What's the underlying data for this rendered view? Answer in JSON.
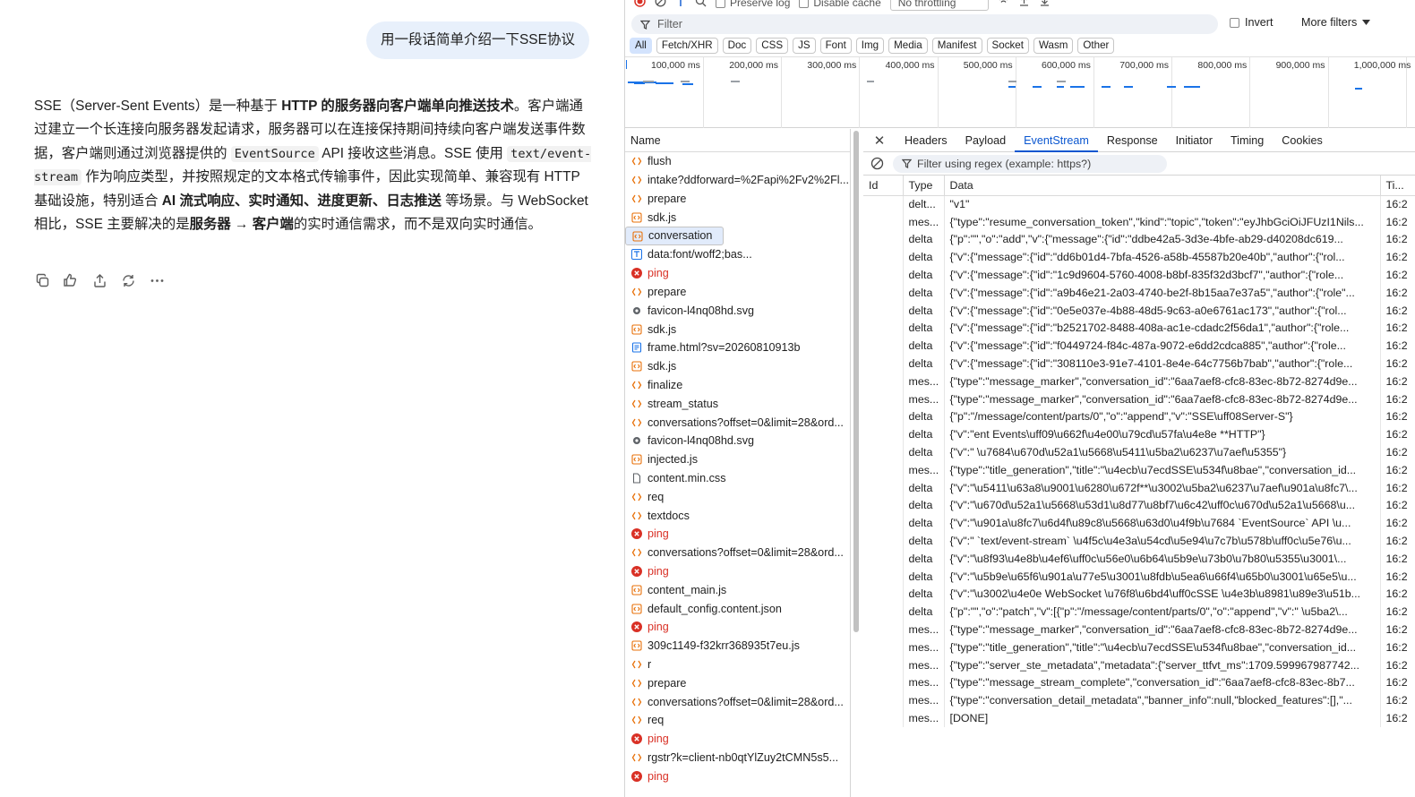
{
  "chat": {
    "user_message": "用一段话简单介绍一下SSE协议",
    "answer": {
      "p1": "SSE（Server-Sent Events）是一种基于 ",
      "b1": "HTTP 的服务器向客户端单向推送技术",
      "p2": "。客户端通过建立一个长连接向服务器发起请求，服务器可以在连接保持期间持续向客户端发送事件数据，客户端则通过浏览器提供的 ",
      "c1": "EventSource",
      "p3": " API 接收这些消息。SSE 使用 ",
      "c2": "text/event-stream",
      "p4": " 作为响应类型，并按照规定的文本格式传输事件，因此实现简单、兼容现有 HTTP 基础设施，特别适合 ",
      "b2": "AI 流式响应、实时通知、进度更新、日志推送",
      "p5": " 等场景。与 WebSocket 相比，SSE 主要解决的是",
      "b3": "服务器 → 客户端",
      "p6": "的实时通信需求，而不是双向实时通信。"
    },
    "actions": [
      "copy-icon",
      "thumbs-icon",
      "share-icon",
      "refresh-icon",
      "more-icon"
    ]
  },
  "devtools": {
    "toolbar": {
      "preserve_log": "Preserve log",
      "disable_cache": "Disable cache",
      "throttling": "No throttling"
    },
    "filter_placeholder": "Filter",
    "invert": "Invert",
    "more_filters": "More filters",
    "chips": [
      "All",
      "Fetch/XHR",
      "Doc",
      "CSS",
      "JS",
      "Font",
      "Img",
      "Media",
      "Manifest",
      "Socket",
      "Wasm",
      "Other"
    ],
    "timeline_ticks": [
      "100,000 ms",
      "200,000 ms",
      "300,000 ms",
      "400,000 ms",
      "500,000 ms",
      "600,000 ms",
      "700,000 ms",
      "800,000 ms",
      "900,000 ms",
      "1,000,000 ms"
    ],
    "name_header": "Name",
    "requests": [
      {
        "name": "flush",
        "icon": "fetch-icon",
        "error": false
      },
      {
        "name": "intake?ddforward=%2Fapi%2Fv2%2Fl...",
        "icon": "fetch-icon",
        "error": false
      },
      {
        "name": "prepare",
        "icon": "fetch-icon",
        "error": false
      },
      {
        "name": "sdk.js",
        "icon": "script-icon",
        "error": false
      },
      {
        "name": "conversation",
        "icon": "script-icon",
        "error": false,
        "selected": true
      },
      {
        "name": "data:font/woff2;bas...",
        "icon": "font-icon",
        "error": false
      },
      {
        "name": "ping",
        "icon": "error-icon",
        "error": true
      },
      {
        "name": "prepare",
        "icon": "fetch-icon",
        "error": false
      },
      {
        "name": "favicon-l4nq08hd.svg",
        "icon": "image-icon",
        "error": false
      },
      {
        "name": "sdk.js",
        "icon": "script-icon",
        "error": false
      },
      {
        "name": "frame.html?sv=20260810913b",
        "icon": "document-icon",
        "error": false
      },
      {
        "name": "sdk.js",
        "icon": "script-icon",
        "error": false
      },
      {
        "name": "finalize",
        "icon": "fetch-icon",
        "error": false
      },
      {
        "name": "stream_status",
        "icon": "fetch-icon",
        "error": false
      },
      {
        "name": "conversations?offset=0&limit=28&ord...",
        "icon": "fetch-icon",
        "error": false
      },
      {
        "name": "favicon-l4nq08hd.svg",
        "icon": "image-icon",
        "error": false
      },
      {
        "name": "injected.js",
        "icon": "script-icon",
        "error": false
      },
      {
        "name": "content.min.css",
        "icon": "file-icon",
        "error": false
      },
      {
        "name": "req",
        "icon": "fetch-icon",
        "error": false
      },
      {
        "name": "textdocs",
        "icon": "fetch-icon",
        "error": false
      },
      {
        "name": "ping",
        "icon": "error-icon",
        "error": true
      },
      {
        "name": "conversations?offset=0&limit=28&ord...",
        "icon": "fetch-icon",
        "error": false
      },
      {
        "name": "ping",
        "icon": "error-icon",
        "error": true
      },
      {
        "name": "content_main.js",
        "icon": "script-icon",
        "error": false
      },
      {
        "name": "default_config.content.json",
        "icon": "script-icon",
        "error": false
      },
      {
        "name": "ping",
        "icon": "error-icon",
        "error": true
      },
      {
        "name": "309c1149-f32krr368935t7eu.js",
        "icon": "script-icon",
        "error": false
      },
      {
        "name": "r",
        "icon": "fetch-icon",
        "error": false
      },
      {
        "name": "prepare",
        "icon": "fetch-icon",
        "error": false
      },
      {
        "name": "conversations?offset=0&limit=28&ord...",
        "icon": "fetch-icon",
        "error": false
      },
      {
        "name": "req",
        "icon": "fetch-icon",
        "error": false
      },
      {
        "name": "ping",
        "icon": "error-icon",
        "error": true
      },
      {
        "name": "rgstr?k=client-nb0qtYlZuy2tCMN5s5...",
        "icon": "fetch-icon",
        "error": false
      },
      {
        "name": "ping",
        "icon": "error-icon",
        "error": true
      }
    ],
    "detail_tabs": [
      "Headers",
      "Payload",
      "EventStream",
      "Response",
      "Initiator",
      "Timing",
      "Cookies"
    ],
    "active_tab": "EventStream",
    "event_filter_placeholder": "Filter using regex (example: https?)",
    "event_columns": [
      "Id",
      "Type",
      "Data",
      "Ti..."
    ],
    "events": [
      {
        "type": "delt...",
        "data": "\"v1\"",
        "time": "16:2"
      },
      {
        "type": "mes...",
        "data": "{\"type\":\"resume_conversation_token\",\"kind\":\"topic\",\"token\":\"eyJhbGciOiJFUzI1Nils...",
        "time": "16:2"
      },
      {
        "type": "delta",
        "data": "{\"p\":\"\",\"o\":\"add\",\"v\":{\"message\":{\"id\":\"ddbe42a5-3d3e-4bfe-ab29-d40208dc619...",
        "time": "16:2"
      },
      {
        "type": "delta",
        "data": "{\"v\":{\"message\":{\"id\":\"dd6b01d4-7bfa-4526-a58b-45587b20e40b\",\"author\":{\"rol...",
        "time": "16:2"
      },
      {
        "type": "delta",
        "data": "{\"v\":{\"message\":{\"id\":\"1c9d9604-5760-4008-b8bf-835f32d3bcf7\",\"author\":{\"role...",
        "time": "16:2"
      },
      {
        "type": "delta",
        "data": "{\"v\":{\"message\":{\"id\":\"a9b46e21-2a03-4740-be2f-8b15aa7e37a5\",\"author\":{\"role\"...",
        "time": "16:2"
      },
      {
        "type": "delta",
        "data": "{\"v\":{\"message\":{\"id\":\"0e5e037e-4b88-48d5-9c63-a0e6761ac173\",\"author\":{\"rol...",
        "time": "16:2"
      },
      {
        "type": "delta",
        "data": "{\"v\":{\"message\":{\"id\":\"b2521702-8488-408a-ac1e-cdadc2f56da1\",\"author\":{\"role...",
        "time": "16:2"
      },
      {
        "type": "delta",
        "data": "{\"v\":{\"message\":{\"id\":\"f0449724-f84c-487a-9072-e6dd2cdca885\",\"author\":{\"role...",
        "time": "16:2"
      },
      {
        "type": "delta",
        "data": "{\"v\":{\"message\":{\"id\":\"308110e3-91e7-4101-8e4e-64c7756b7bab\",\"author\":{\"role...",
        "time": "16:2"
      },
      {
        "type": "mes...",
        "data": "{\"type\":\"message_marker\",\"conversation_id\":\"6aa7aef8-cfc8-83ec-8b72-8274d9e...",
        "time": "16:2"
      },
      {
        "type": "mes...",
        "data": "{\"type\":\"message_marker\",\"conversation_id\":\"6aa7aef8-cfc8-83ec-8b72-8274d9e...",
        "time": "16:2"
      },
      {
        "type": "delta",
        "data": "{\"p\":\"/message/content/parts/0\",\"o\":\"append\",\"v\":\"SSE\\uff08Server-S\"}",
        "time": "16:2"
      },
      {
        "type": "delta",
        "data": "{\"v\":\"ent Events\\uff09\\u662f\\u4e00\\u79cd\\u57fa\\u4e8e **HTTP\"}",
        "time": "16:2"
      },
      {
        "type": "delta",
        "data": "{\"v\":\" \\u7684\\u670d\\u52a1\\u5668\\u5411\\u5ba2\\u6237\\u7aef\\u5355\"}",
        "time": "16:2"
      },
      {
        "type": "mes...",
        "data": "{\"type\":\"title_generation\",\"title\":\"\\u4ecb\\u7ecdSSE\\u534f\\u8bae\",\"conversation_id...",
        "time": "16:2"
      },
      {
        "type": "delta",
        "data": "{\"v\":\"\\u5411\\u63a8\\u9001\\u6280\\u672f**\\u3002\\u5ba2\\u6237\\u7aef\\u901a\\u8fc7\\...",
        "time": "16:2"
      },
      {
        "type": "delta",
        "data": "{\"v\":\"\\u670d\\u52a1\\u5668\\u53d1\\u8d77\\u8bf7\\u6c42\\uff0c\\u670d\\u52a1\\u5668\\u...",
        "time": "16:2"
      },
      {
        "type": "delta",
        "data": "{\"v\":\"\\u901a\\u8fc7\\u6d4f\\u89c8\\u5668\\u63d0\\u4f9b\\u7684 `EventSource` API \\u...",
        "time": "16:2"
      },
      {
        "type": "delta",
        "data": "{\"v\":\" `text/event-stream` \\u4f5c\\u4e3a\\u54cd\\u5e94\\u7c7b\\u578b\\uff0c\\u5e76\\u...",
        "time": "16:2"
      },
      {
        "type": "delta",
        "data": "{\"v\":\"\\u8f93\\u4e8b\\u4ef6\\uff0c\\u56e0\\u6b64\\u5b9e\\u73b0\\u7b80\\u5355\\u3001\\...",
        "time": "16:2"
      },
      {
        "type": "delta",
        "data": "{\"v\":\"\\u5b9e\\u65f6\\u901a\\u77e5\\u3001\\u8fdb\\u5ea6\\u66f4\\u65b0\\u3001\\u65e5\\u...",
        "time": "16:2"
      },
      {
        "type": "delta",
        "data": "{\"v\":\"\\u3002\\u4e0e WebSocket \\u76f8\\u6bd4\\uff0cSSE \\u4e3b\\u8981\\u89e3\\u51b...",
        "time": "16:2"
      },
      {
        "type": "delta",
        "data": "{\"p\":\"\",\"o\":\"patch\",\"v\":[{\"p\":\"/message/content/parts/0\",\"o\":\"append\",\"v\":\" \\u5ba2\\...",
        "time": "16:2"
      },
      {
        "type": "mes...",
        "data": "{\"type\":\"message_marker\",\"conversation_id\":\"6aa7aef8-cfc8-83ec-8b72-8274d9e...",
        "time": "16:2"
      },
      {
        "type": "mes...",
        "data": "{\"type\":\"title_generation\",\"title\":\"\\u4ecb\\u7ecdSSE\\u534f\\u8bae\",\"conversation_id...",
        "time": "16:2"
      },
      {
        "type": "mes...",
        "data": "{\"type\":\"server_ste_metadata\",\"metadata\":{\"server_ttfvt_ms\":1709.599967987742...",
        "time": "16:2"
      },
      {
        "type": "mes...",
        "data": "{\"type\":\"message_stream_complete\",\"conversation_id\":\"6aa7aef8-cfc8-83ec-8b7...",
        "time": "16:2"
      },
      {
        "type": "mes...",
        "data": "{\"type\":\"conversation_detail_metadata\",\"banner_info\":null,\"blocked_features\":[],\"...",
        "time": "16:2"
      },
      {
        "type": "mes...",
        "data": "[DONE]",
        "time": "16:2"
      }
    ]
  }
}
